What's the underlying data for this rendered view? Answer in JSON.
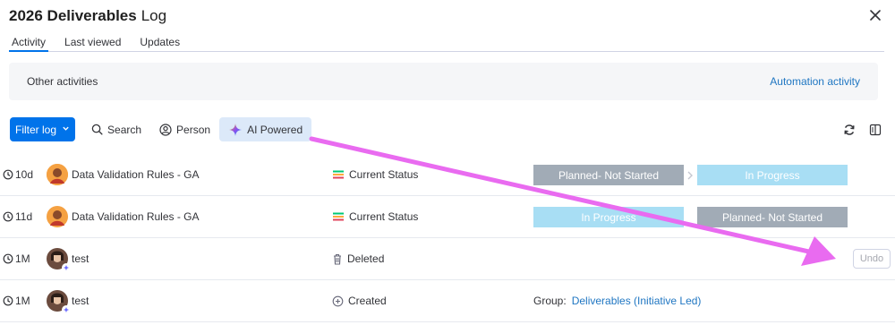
{
  "header": {
    "title_bold": "2026 Deliverables",
    "title_rest": "Log"
  },
  "tabs": [
    {
      "label": "Activity",
      "active": true
    },
    {
      "label": "Last viewed",
      "active": false
    },
    {
      "label": "Updates",
      "active": false
    }
  ],
  "other_bar": {
    "label": "Other activities",
    "link": "Automation activity"
  },
  "toolbar": {
    "filter_label": "Filter log",
    "search_label": "Search",
    "person_label": "Person",
    "ai_label": "AI Powered"
  },
  "rows": [
    {
      "time": "10d",
      "item": "Data Validation Rules - GA",
      "action": "Current Status",
      "from": "Planned- Not Started",
      "to": "In Progress"
    },
    {
      "time": "11d",
      "item": "Data Validation Rules - GA",
      "action": "Current Status",
      "from": "In Progress",
      "to": "Planned- Not Started"
    },
    {
      "time": "1M",
      "item": "test",
      "action": "Deleted",
      "undo": "Undo"
    },
    {
      "time": "1M",
      "item": "test",
      "action": "Created",
      "group_label": "Group:",
      "group_value": "Deliverables (Initiative Led)"
    }
  ],
  "colors": {
    "accent": "#0073ea",
    "planned": "#a1abb6",
    "in_progress": "#a8def4",
    "annotation_arrow": "#e96bf0",
    "ai_bg": "#dce9f9"
  },
  "icons": {
    "close": "close-icon",
    "search": "search-icon",
    "person": "person-icon",
    "ai": "sparkle-icon",
    "refresh": "refresh-icon",
    "split": "split-view-icon",
    "clock": "clock-icon",
    "status": "status-column-icon",
    "trash": "trash-icon",
    "created": "plus-circle-icon"
  }
}
